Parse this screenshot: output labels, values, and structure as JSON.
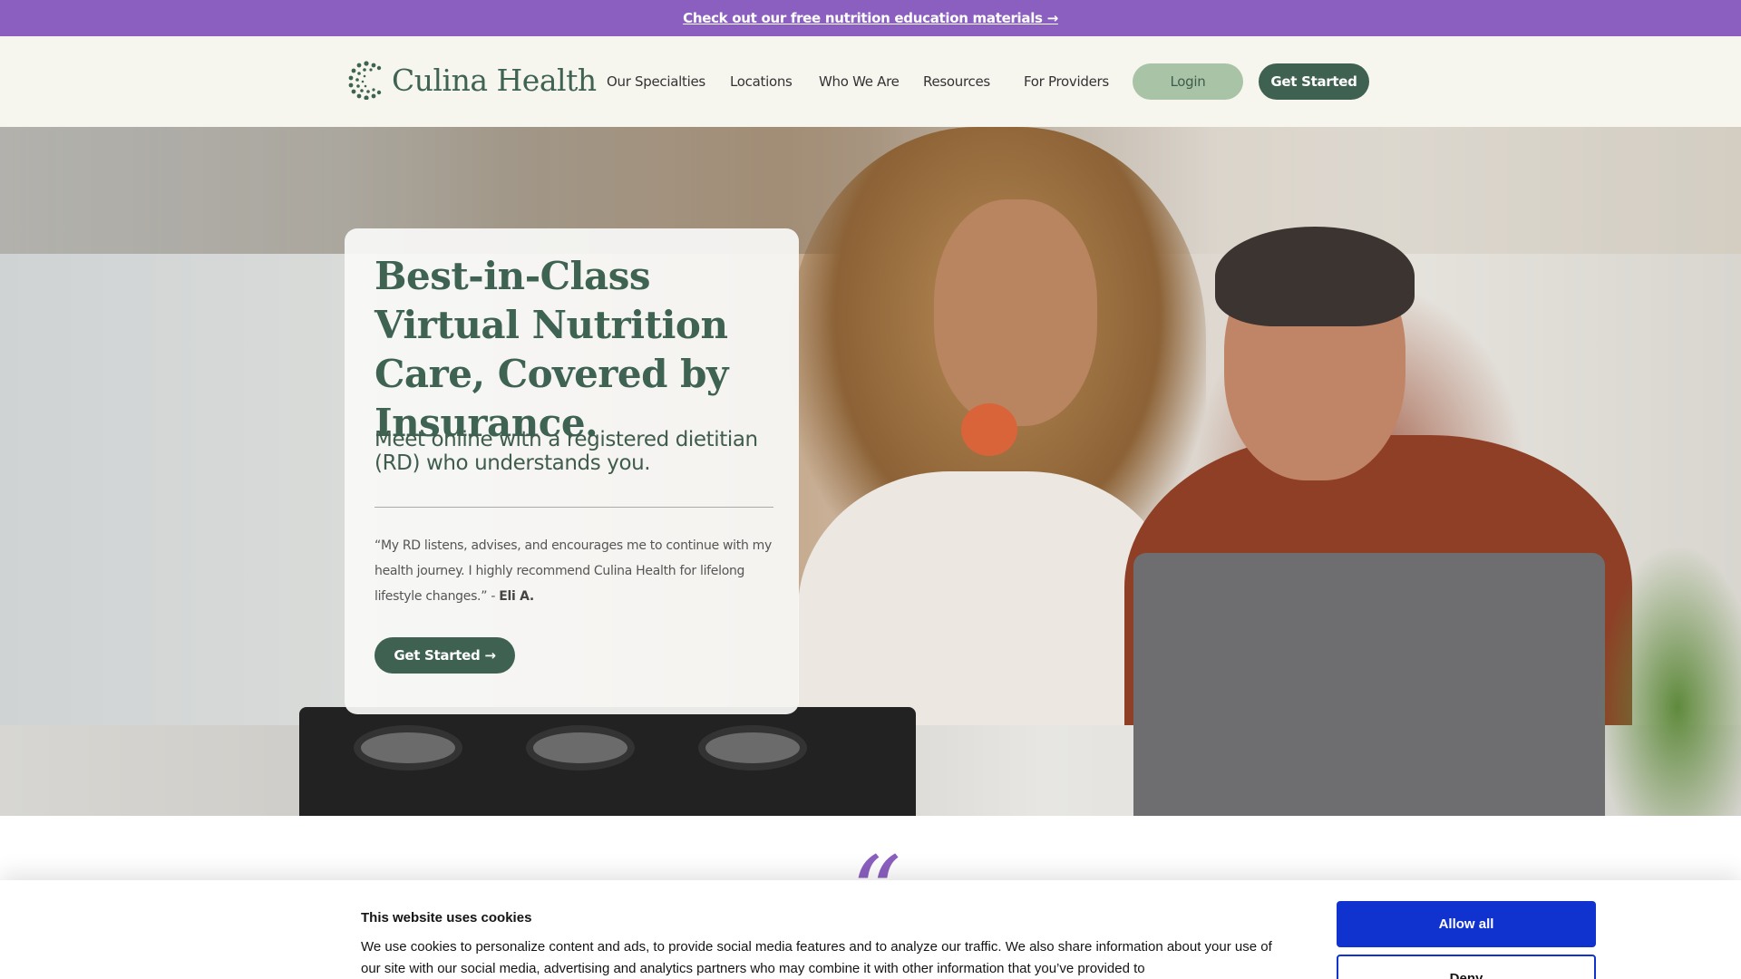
{
  "announcement": {
    "text": "Check out our free nutrition education materials →"
  },
  "header": {
    "logo_text": "Culina Health",
    "nav": [
      {
        "label": "Our Specialties"
      },
      {
        "label": "Locations"
      },
      {
        "label": "Who We Are"
      },
      {
        "label": "Resources"
      },
      {
        "label": "For Providers"
      }
    ],
    "login_label": "Login",
    "get_started_label": "Get Started"
  },
  "hero": {
    "title": "Best-in-Class Virtual Nutrition Care, Covered by Insurance.",
    "subtitle": "Meet online with a registered dietitian (RD) who understands you.",
    "testimonial": "“My RD listens, advises, and encourages me to continue with my health journey. I highly recommend Culina Health for lifelong lifestyle changes.” -",
    "testimonial_author": "Eli A.",
    "cta_label": "Get Started →"
  },
  "quote_mark": "“",
  "cookie": {
    "title": "This website uses cookies",
    "text": "We use cookies to personalize content and ads, to provide social media features and to analyze our traffic. We also share information about your use of our site with our social media, advertising and analytics partners who may combine it with other information that you’ve provided to",
    "allow_label": "Allow all",
    "deny_label": "Deny"
  },
  "colors": {
    "announcement_bg": "#8b5fbf",
    "header_bg": "#f7f6ee",
    "brand_green": "#3e6151",
    "login_bg": "#a9c3a6",
    "cookie_accent": "#1032cf"
  },
  "icons": {
    "logo": "culina-dots-logo-icon"
  }
}
